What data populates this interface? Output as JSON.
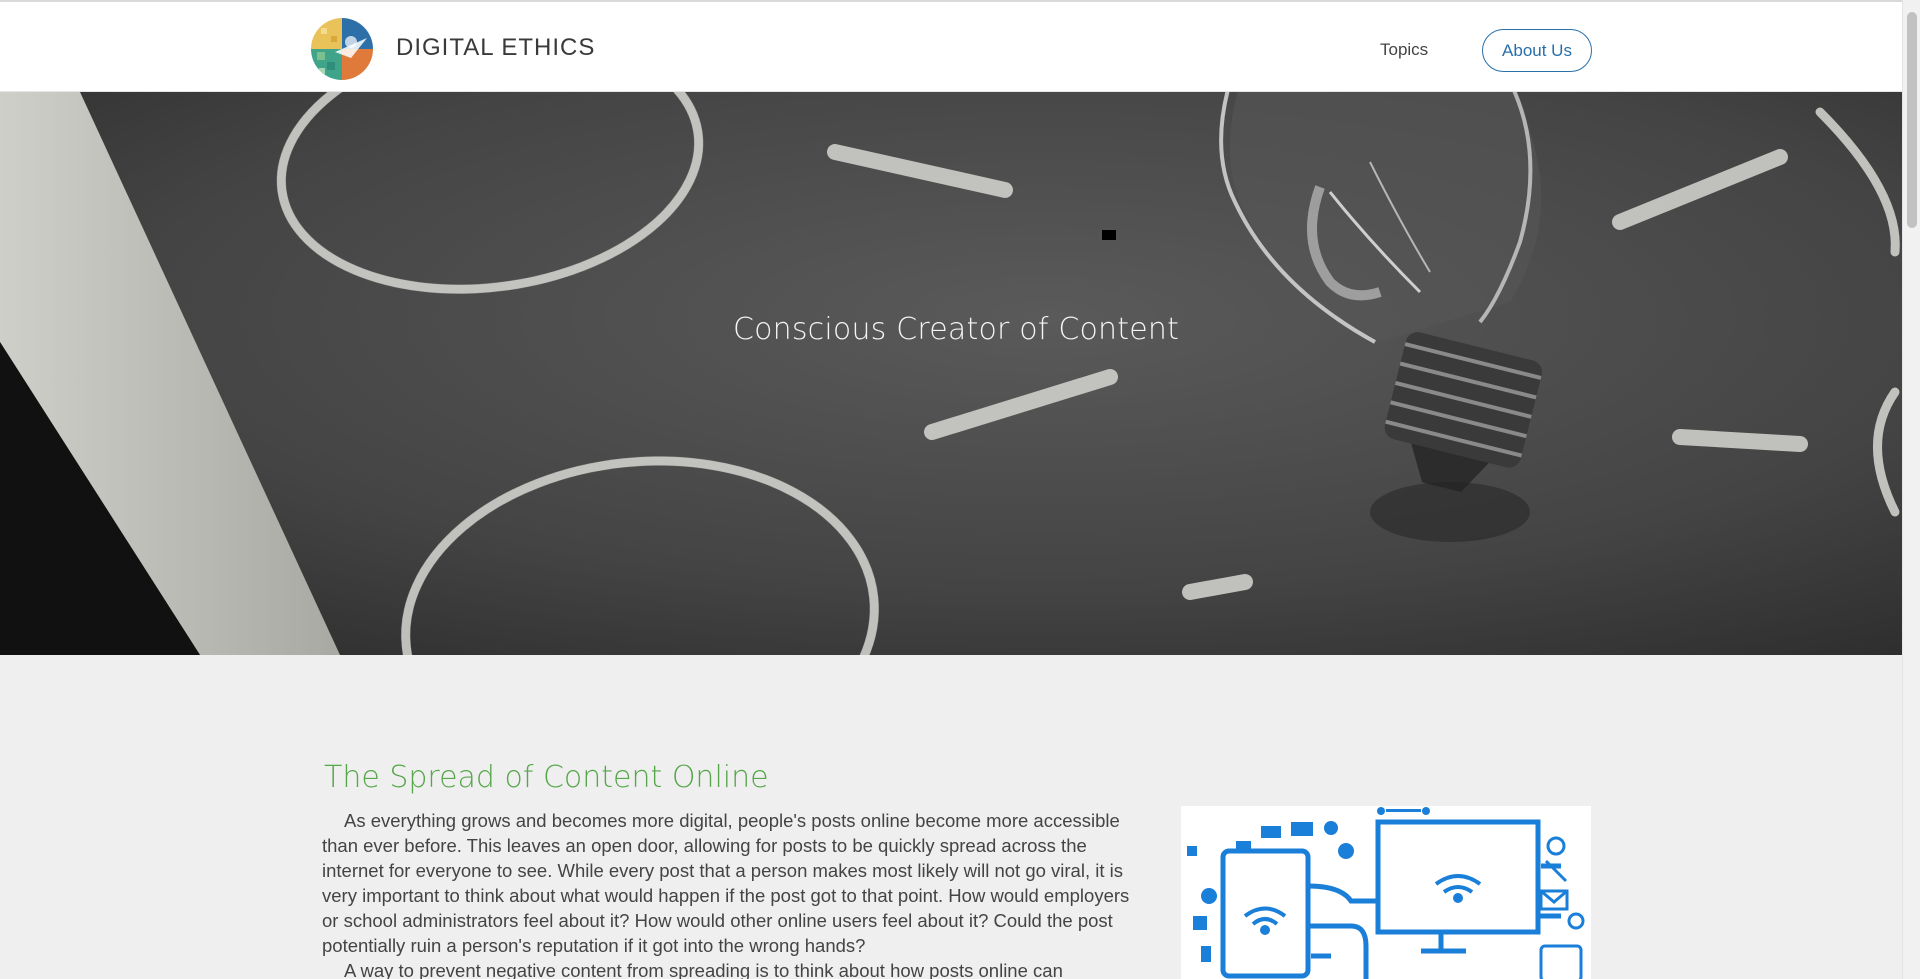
{
  "header": {
    "site_title": "DIGITAL ETHICS",
    "nav": {
      "topics": "Topics",
      "about": "About Us"
    }
  },
  "hero": {
    "title": "Conscious Creator of Content"
  },
  "section": {
    "title": "The Spread of Content Online",
    "paragraph1": "As everything grows and becomes more digital, people's posts online become more accessible than ever before. This leaves an open door, allowing for posts to be quickly spread across the internet for everyone to see. While every post that a person makes most likely will not go viral, it is very important to think about what would happen if the post got to that point. How would employers or school administrators feel about it? How would other online users feel about it? Could the post potentially ruin a person's reputation if it got into the wrong hands?",
    "paragraph2": "A way to prevent negative content from spreading is to think about how posts online can"
  },
  "colors": {
    "accent_green": "#56a64a",
    "nav_blue": "#2a6fa8",
    "illustration_blue": "#1a7fd8"
  },
  "icons": [
    "logo-icon",
    "lightbulb-icon",
    "tablet-icon",
    "monitor-icon",
    "wifi-icon",
    "email-icon",
    "phone-icon",
    "at-icon"
  ]
}
